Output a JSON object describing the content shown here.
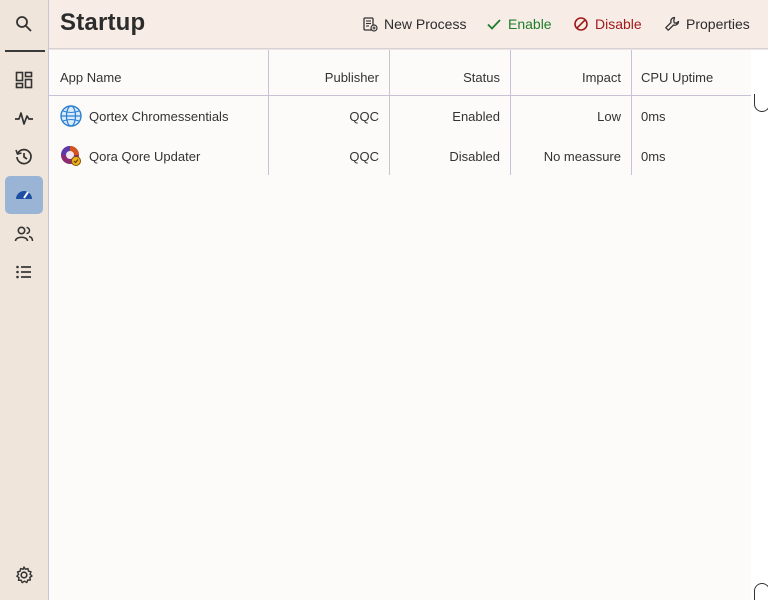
{
  "page": {
    "title": "Startup"
  },
  "sidebar": {
    "items": [
      {
        "name": "search-icon"
      },
      {
        "name": "dashboard-icon"
      },
      {
        "name": "performance-icon"
      },
      {
        "name": "history-icon"
      },
      {
        "name": "startup-gauge-icon",
        "active": true
      },
      {
        "name": "users-icon"
      },
      {
        "name": "details-list-icon"
      },
      {
        "name": "settings-gear-icon"
      }
    ]
  },
  "toolbar": {
    "new_process": "New Process",
    "enable": "Enable",
    "disable": "Disable",
    "properties": "Properties"
  },
  "colors": {
    "enable": "#1e7d2b",
    "disable": "#a11a1a",
    "active_nav": "#9ab4d6"
  },
  "table": {
    "columns": [
      "App Name",
      "Publisher",
      "Status",
      "Impact",
      "CPU Uptime"
    ],
    "rows": [
      {
        "app": "Qortex Chromessentials",
        "icon": "globe-icon",
        "publisher": "QQC",
        "status": "Enabled",
        "impact": "Low",
        "cpu": "0ms"
      },
      {
        "app": "Qora Qore Updater",
        "icon": "updater-icon",
        "publisher": "QQC",
        "status": "Disabled",
        "impact": "No meassure",
        "cpu": "0ms"
      }
    ]
  }
}
